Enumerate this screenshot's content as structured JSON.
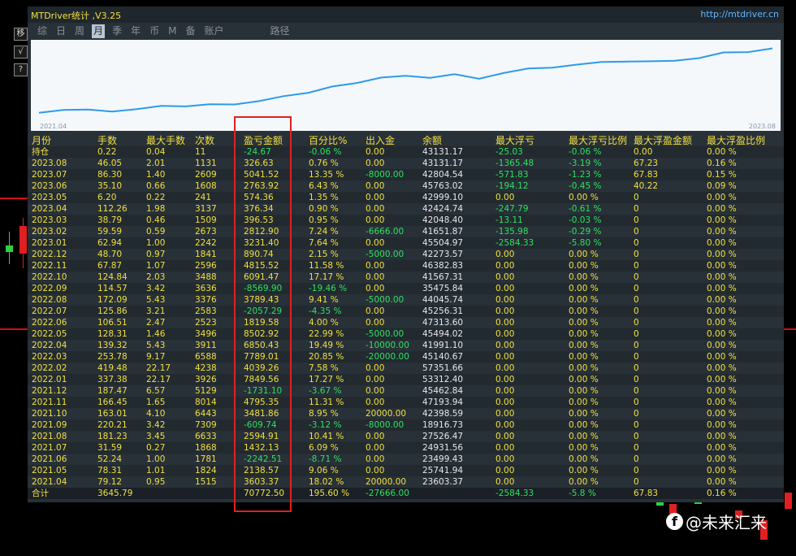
{
  "window": {
    "title": "MTDriver统计 ,V3.25",
    "url": "http://mtdriver.cn"
  },
  "side_buttons": [
    "移",
    "√",
    "?"
  ],
  "tabs": [
    {
      "label": "综"
    },
    {
      "label": "日"
    },
    {
      "label": "周"
    },
    {
      "label": "月",
      "active": true
    },
    {
      "label": "季"
    },
    {
      "label": "年"
    },
    {
      "label": "币"
    },
    {
      "label": "M"
    },
    {
      "label": "备"
    },
    {
      "label": "账户"
    },
    {
      "label": "路径"
    }
  ],
  "chart": {
    "start_label": "2021.04",
    "end_label": "2023.08",
    "line_color": "#2d9be8",
    "equity_series": [
      3603.37,
      6707.64,
      7209.37,
      4966.86,
      7561.77,
      11043.63,
      10433.89,
      12814.76,
      12482.84,
      16057.35,
      21364.17,
      24798.24,
      31648.67,
      35300.16,
      41101.25,
      42921.04,
      40863.75,
      44653.18,
      39944.33,
      45900.62,
      50716.14,
      51606.88,
      54838.09,
      57650.99,
      58047.33,
      58423.67,
      58998.03,
      61761.95,
      67802.06,
      68126.31,
      72126.31
    ]
  },
  "highlight_color": "#e02020",
  "table": {
    "headers": [
      "月份",
      "手数",
      "最大手数",
      "次数",
      "盈亏金额",
      "百分比%",
      "出入金",
      "余额",
      "最大浮亏",
      "最大浮亏比例",
      "最大浮盈金额",
      "最大浮盈比例"
    ],
    "rows": [
      [
        "持仓",
        "0.22",
        "0.04",
        "11",
        "-24.67",
        "-0.06 %",
        "0.00",
        "43131.17",
        "-25.03",
        "-0.06 %",
        "0.00",
        "0.00 %"
      ],
      [
        "2023.08",
        "46.05",
        "2.01",
        "1131",
        "326.63",
        "0.76 %",
        "0.00",
        "43131.17",
        "-1365.48",
        "-3.19 %",
        "67.23",
        "0.16 %"
      ],
      [
        "2023.07",
        "86.30",
        "1.40",
        "2609",
        "5041.52",
        "13.35 %",
        "-8000.00",
        "42804.54",
        "-571.83",
        "-1.23 %",
        "67.83",
        "0.15 %"
      ],
      [
        "2023.06",
        "35.10",
        "0.66",
        "1608",
        "2763.92",
        "6.43 %",
        "0.00",
        "45763.02",
        "-194.12",
        "-0.45 %",
        "40.22",
        "0.09 %"
      ],
      [
        "2023.05",
        "6.20",
        "0.22",
        "241",
        "574.36",
        "1.35 %",
        "0.00",
        "42999.10",
        "0.00",
        "0.00 %",
        "0",
        "0.00 %"
      ],
      [
        "2023.04",
        "112.26",
        "1.98",
        "3137",
        "376.34",
        "0.90 %",
        "0.00",
        "42424.74",
        "-247.79",
        "-0.61 %",
        "0",
        "0.00 %"
      ],
      [
        "2023.03",
        "38.79",
        "0.46",
        "1509",
        "396.53",
        "0.95 %",
        "0.00",
        "42048.40",
        "-13.11",
        "-0.03 %",
        "0",
        "0.00 %"
      ],
      [
        "2023.02",
        "59.59",
        "0.59",
        "2673",
        "2812.90",
        "7.24 %",
        "-6666.00",
        "41651.87",
        "-135.98",
        "-0.29 %",
        "0",
        "0.00 %"
      ],
      [
        "2023.01",
        "62.94",
        "1.00",
        "2242",
        "3231.40",
        "7.64 %",
        "0.00",
        "45504.97",
        "-2584.33",
        "-5.80 %",
        "0",
        "0.00 %"
      ],
      [
        "2022.12",
        "48.70",
        "0.97",
        "1841",
        "890.74",
        "2.15 %",
        "-5000.00",
        "42273.57",
        "0.00",
        "0.00 %",
        "0",
        "0.00 %"
      ],
      [
        "2022.11",
        "67.87",
        "1.07",
        "2596",
        "4815.52",
        "11.58 %",
        "0.00",
        "46382.83",
        "0.00",
        "0.00 %",
        "0",
        "0.00 %"
      ],
      [
        "2022.10",
        "124.84",
        "2.03",
        "3488",
        "6091.47",
        "17.17 %",
        "0.00",
        "41567.31",
        "0.00",
        "0.00 %",
        "0",
        "0.00 %"
      ],
      [
        "2022.09",
        "114.57",
        "3.42",
        "3636",
        "-8569.90",
        "-19.46 %",
        "0.00",
        "35475.84",
        "0.00",
        "0.00 %",
        "0",
        "0.00 %"
      ],
      [
        "2022.08",
        "172.09",
        "5.43",
        "3376",
        "3789.43",
        "9.41 %",
        "-5000.00",
        "44045.74",
        "0.00",
        "0.00 %",
        "0",
        "0.00 %"
      ],
      [
        "2022.07",
        "125.86",
        "3.21",
        "2583",
        "-2057.29",
        "-4.35 %",
        "0.00",
        "45256.31",
        "0.00",
        "0.00 %",
        "0",
        "0.00 %"
      ],
      [
        "2022.06",
        "106.51",
        "2.47",
        "2523",
        "1819.58",
        "4.00 %",
        "0.00",
        "47313.60",
        "0.00",
        "0.00 %",
        "0",
        "0.00 %"
      ],
      [
        "2022.05",
        "128.31",
        "1.46",
        "3496",
        "8502.92",
        "22.99 %",
        "-5000.00",
        "45494.02",
        "0.00",
        "0.00 %",
        "0",
        "0.00 %"
      ],
      [
        "2022.04",
        "139.32",
        "5.43",
        "3911",
        "6850.43",
        "19.49 %",
        "-10000.00",
        "41991.10",
        "0.00",
        "0.00 %",
        "0",
        "0.00 %"
      ],
      [
        "2022.03",
        "253.78",
        "9.17",
        "6588",
        "7789.01",
        "20.85 %",
        "-20000.00",
        "45140.67",
        "0.00",
        "0.00 %",
        "0",
        "0.00 %"
      ],
      [
        "2022.02",
        "419.48",
        "22.17",
        "4238",
        "4039.26",
        "7.58 %",
        "0.00",
        "57351.66",
        "0.00",
        "0.00 %",
        "0",
        "0.00 %"
      ],
      [
        "2022.01",
        "337.38",
        "22.17",
        "3926",
        "7849.56",
        "17.27 %",
        "0.00",
        "53312.40",
        "0.00",
        "0.00 %",
        "0",
        "0.00 %"
      ],
      [
        "2021.12",
        "187.47",
        "6.57",
        "5129",
        "-1731.10",
        "-3.67 %",
        "0.00",
        "45462.84",
        "0.00",
        "0.00 %",
        "0",
        "0.00 %"
      ],
      [
        "2021.11",
        "166.45",
        "1.65",
        "8014",
        "4795.35",
        "11.31 %",
        "0.00",
        "47193.94",
        "0.00",
        "0.00 %",
        "0",
        "0.00 %"
      ],
      [
        "2021.10",
        "163.01",
        "4.10",
        "6443",
        "3481.86",
        "8.95 %",
        "20000.00",
        "42398.59",
        "0.00",
        "0.00 %",
        "0",
        "0.00 %"
      ],
      [
        "2021.09",
        "220.21",
        "3.42",
        "7309",
        "-609.74",
        "-3.12 %",
        "-8000.00",
        "18916.73",
        "0.00",
        "0.00 %",
        "0",
        "0.00 %"
      ],
      [
        "2021.08",
        "181.23",
        "3.45",
        "6633",
        "2594.91",
        "10.41 %",
        "0.00",
        "27526.47",
        "0.00",
        "0.00 %",
        "0",
        "0.00 %"
      ],
      [
        "2021.07",
        "31.59",
        "0.27",
        "1868",
        "1432.13",
        "6.09 %",
        "0.00",
        "24931.56",
        "0.00",
        "0.00 %",
        "0",
        "0.00 %"
      ],
      [
        "2021.06",
        "52.24",
        "1.00",
        "1781",
        "-2242.51",
        "-8.71 %",
        "0.00",
        "23499.43",
        "0.00",
        "0.00 %",
        "0",
        "0.00 %"
      ],
      [
        "2021.05",
        "78.31",
        "1.01",
        "1824",
        "2138.57",
        "9.06 %",
        "0.00",
        "25741.94",
        "0.00",
        "0.00 %",
        "0",
        "0.00 %"
      ],
      [
        "2021.04",
        "79.12",
        "0.95",
        "1515",
        "3603.37",
        "18.02 %",
        "20000.00",
        "23603.37",
        "0.00",
        "0.00 %",
        "0",
        "0.00 %"
      ]
    ],
    "total": [
      "合计",
      "3645.79",
      "",
      "",
      "70772.50",
      "195.60 %",
      "-27666.00",
      "",
      "-2584.33",
      "-5.8 %",
      "67.83",
      "0.16 %"
    ]
  },
  "watermark": {
    "icon": "f",
    "text": "@未来汇来"
  }
}
